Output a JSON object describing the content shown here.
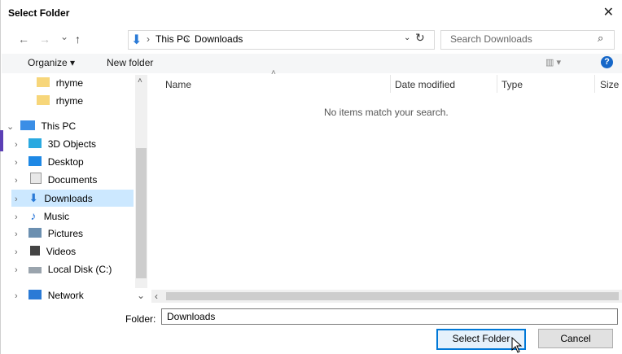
{
  "window": {
    "title": "Select Folder",
    "close_glyph": "✕"
  },
  "navbar": {
    "back_glyph": "←",
    "forward_glyph": "→",
    "recent_glyph": "⌄",
    "up_glyph": "↑",
    "crumb_sep": "›",
    "breadcrumb": [
      "This PC",
      "Downloads"
    ],
    "dropdown_glyph": "⌄",
    "refresh_glyph": "↻",
    "search_placeholder": "Search Downloads",
    "search_glyph": "⌕"
  },
  "commandbar": {
    "organize": "Organize ▾",
    "new_folder": "New folder",
    "view_glyph": "▥ ▾",
    "help_glyph": "?"
  },
  "nav_items": [
    {
      "label": "rhyme",
      "icon": "folder-icon",
      "indent": 1
    },
    {
      "label": "rhyme",
      "icon": "folder-icon",
      "indent": 1
    },
    {
      "label": "This PC",
      "icon": "computer-icon",
      "chevron": "⌄",
      "indent": 0
    },
    {
      "label": "3D Objects",
      "icon": "cube-icon",
      "chevron": "›",
      "indent": 1
    },
    {
      "label": "Desktop",
      "icon": "desktop-icon",
      "chevron": "›",
      "indent": 1
    },
    {
      "label": "Documents",
      "icon": "document-icon",
      "chevron": "›",
      "indent": 1
    },
    {
      "label": "Downloads",
      "icon": "download-icon",
      "chevron": "›",
      "indent": 1,
      "selected": true
    },
    {
      "label": "Music",
      "icon": "music-icon",
      "chevron": "›",
      "indent": 1
    },
    {
      "label": "Pictures",
      "icon": "pictures-icon",
      "chevron": "›",
      "indent": 1
    },
    {
      "label": "Videos",
      "icon": "video-icon",
      "chevron": "›",
      "indent": 1
    },
    {
      "label": "Local Disk (C:)",
      "icon": "disk-icon",
      "chevron": "›",
      "indent": 1
    }
  ],
  "network": {
    "label": "Network",
    "chevron": "›",
    "expand_glyph": "⌄"
  },
  "columns": {
    "name": "Name",
    "date_modified": "Date modified",
    "type": "Type",
    "size": "Size",
    "sort_glyph": "˄"
  },
  "empty_message": "No items match your search.",
  "footer": {
    "folder_label": "Folder:",
    "folder_value": "Downloads",
    "select_button": "Select Folder",
    "cancel_button": "Cancel"
  },
  "scroll": {
    "up": "˄",
    "left": "‹",
    "right": "›"
  },
  "colors": {
    "selected_bg": "#cce8ff",
    "accent": "#0078d7"
  }
}
